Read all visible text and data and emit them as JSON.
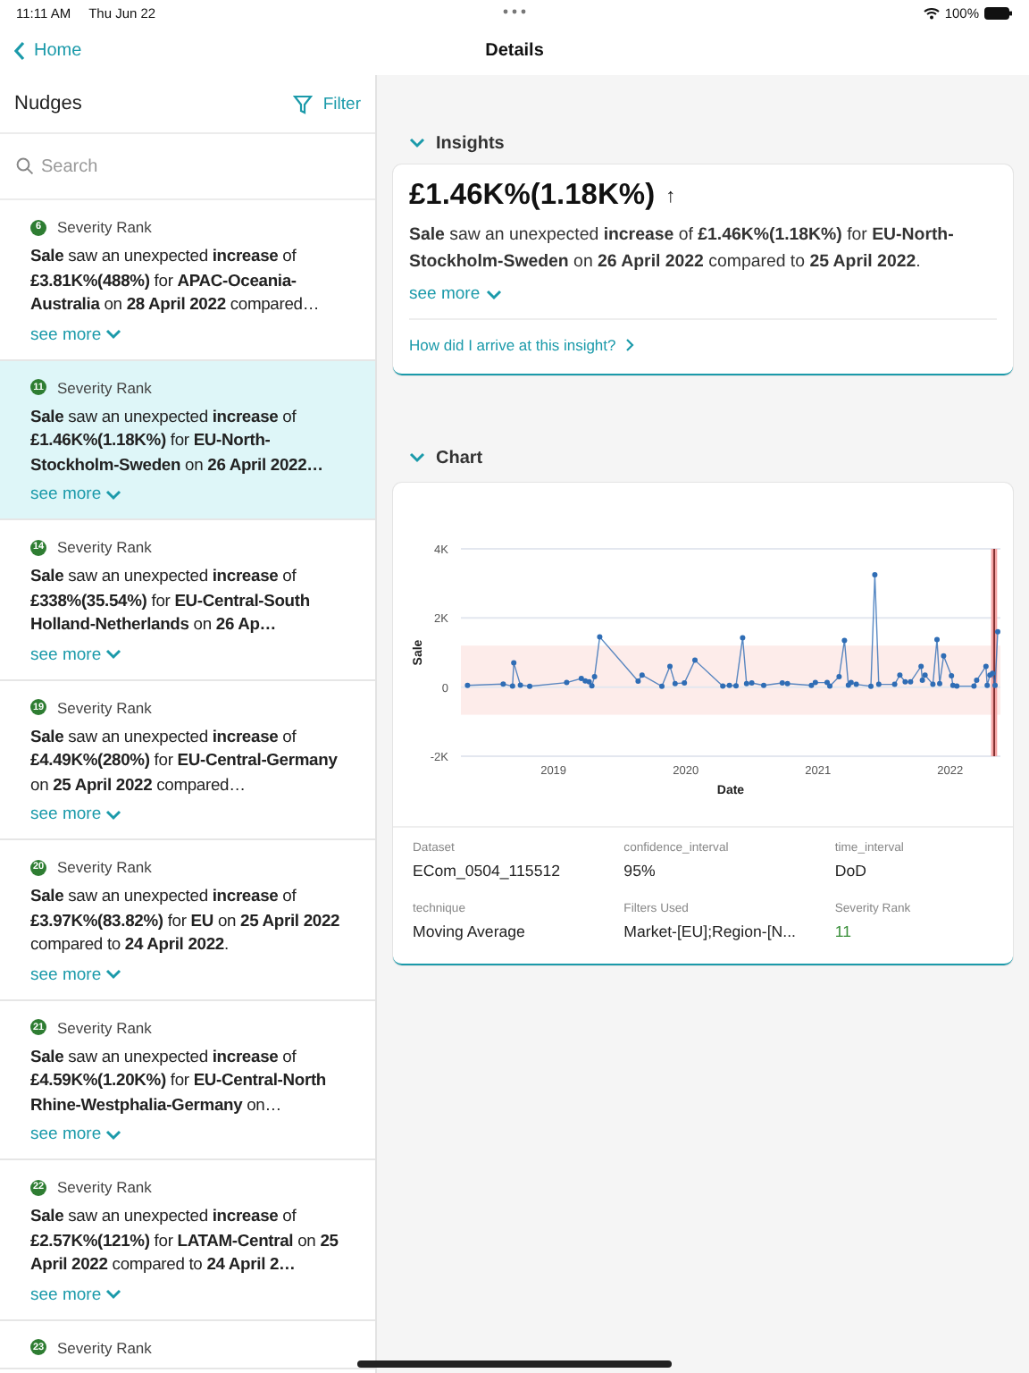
{
  "status_bar": {
    "time": "11:11 AM",
    "date": "Thu Jun 22",
    "battery": "100%"
  },
  "nav": {
    "back": "Home",
    "title": "Details"
  },
  "sidebar": {
    "title": "Nudges",
    "filter": "Filter",
    "search": {
      "placeholder": "Search"
    },
    "nudges": [
      {
        "rank": "6",
        "rank_label": "Severity Rank",
        "text": "**Sale** saw an unexpected **increase** of **£3.81K%(488%)** for **APAC-Oceania-Australia** on **28 April 2022** compared…",
        "see_more": "see more",
        "selected": false
      },
      {
        "rank": "11",
        "rank_label": "Severity Rank",
        "text": "**Sale** saw an unexpected **increase** of **£1.46K%(1.18K%)** for **EU-North-Stockholm-Sweden** on **26 April 2022…**",
        "see_more": "see more",
        "selected": true
      },
      {
        "rank": "14",
        "rank_label": "Severity Rank",
        "text": "**Sale** saw an unexpected **increase** of **£338%(35.54%)** for **EU-Central-South Holland-Netherlands** on **26 Ap…**",
        "see_more": "see more",
        "selected": false
      },
      {
        "rank": "19",
        "rank_label": "Severity Rank",
        "text": "**Sale** saw an unexpected **increase** of **£4.49K%(280%)** for **EU-Central-Germany** on **25 April 2022** compared…",
        "see_more": "see more",
        "selected": false
      },
      {
        "rank": "20",
        "rank_label": "Severity Rank",
        "text": "**Sale** saw an unexpected **increase** of **£3.97K%(83.82%)** for **EU** on **25 April 2022** compared to **24 April 2022**.",
        "see_more": "see more",
        "selected": false
      },
      {
        "rank": "21",
        "rank_label": "Severity Rank",
        "text": "**Sale** saw an unexpected **increase** of **£4.59K%(1.20K%)** for **EU-Central-North Rhine-Westphalia-Germany** on…",
        "see_more": "see more",
        "selected": false
      },
      {
        "rank": "22",
        "rank_label": "Severity Rank",
        "text": "**Sale** saw an unexpected **increase** of **£2.57K%(121%)** for **LATAM-Central** on **25 April 2022** compared to **24 April 2…**",
        "see_more": "see more",
        "selected": false
      },
      {
        "rank": "23",
        "rank_label": "Severity Rank",
        "selected": false
      }
    ]
  },
  "insights": {
    "heading": "Insights",
    "expanded": true,
    "headline": "£1.46K%(1.18K%)",
    "trend": "↑",
    "text": "**Sale** saw an unexpected **increase** of **£1.46K%(1.18K%)** for **EU-North-Stockholm-Sweden** on **26 April 2022** compared to **25 April 2022**.",
    "see_more": "see more",
    "link": "How did I arrive at this insight?"
  },
  "chart_section": {
    "heading": "Chart",
    "expanded": true,
    "chart_data": {
      "type": "line",
      "xlabel": "Date",
      "ylabel": "Sale",
      "xlim": [
        2018.3,
        2022.38
      ],
      "ylim": [
        -2000,
        4000
      ],
      "xticks": [
        2019,
        2020,
        2021,
        2022
      ],
      "yticks": [
        {
          "value": 4000,
          "label": "4K"
        },
        {
          "value": 2000,
          "label": "2K"
        },
        {
          "value": 0,
          "label": "0"
        },
        {
          "value": -2000,
          "label": "-2K"
        }
      ],
      "bands": [
        {
          "axis": "y",
          "from": -800,
          "to": 1200,
          "color": "#fdecea"
        },
        {
          "axis": "x",
          "from": 2022.31,
          "to": 2022.355,
          "color": "#f4a3a3"
        }
      ],
      "ref_lines": [
        {
          "axis": "x",
          "value": 2022.333,
          "color": "#6b1b1b"
        }
      ],
      "series": [
        {
          "color": "#2f6db5",
          "marker": true,
          "x": [
            2018.35,
            2018.62,
            2018.69,
            2018.7,
            2018.75,
            2018.82,
            2019.1,
            2019.21,
            2019.24,
            2019.27,
            2019.29,
            2019.31,
            2019.35,
            2019.64,
            2019.67,
            2019.82,
            2019.88,
            2019.92,
            2019.99,
            2020.07,
            2020.28,
            2020.33,
            2020.38,
            2020.43,
            2020.46,
            2020.5,
            2020.59,
            2020.73,
            2020.77,
            2020.95,
            2020.98,
            2021.07,
            2021.09,
            2021.16,
            2021.2,
            2021.23,
            2021.25,
            2021.29,
            2021.4,
            2021.43,
            2021.46,
            2021.58,
            2021.62,
            2021.66,
            2021.7,
            2021.78,
            2021.79,
            2021.81,
            2021.87,
            2021.9,
            2021.92,
            2021.95,
            2022.01,
            2022.02,
            2022.05,
            2022.18,
            2022.2,
            2022.27,
            2022.28,
            2022.3,
            2022.32,
            2022.34,
            2022.36
          ],
          "values": [
            50,
            90,
            30,
            700,
            60,
            20,
            130,
            250,
            180,
            150,
            40,
            300,
            1450,
            170,
            350,
            20,
            600,
            100,
            120,
            780,
            30,
            50,
            40,
            1430,
            100,
            120,
            50,
            120,
            100,
            50,
            130,
            130,
            30,
            300,
            1350,
            60,
            130,
            80,
            20,
            3250,
            80,
            80,
            350,
            150,
            150,
            600,
            200,
            350,
            80,
            1380,
            100,
            900,
            330,
            50,
            30,
            30,
            200,
            600,
            50,
            350,
            400,
            50,
            1600
          ]
        }
      ]
    },
    "details": [
      {
        "label": "Dataset",
        "value": "ECom_0504_115512",
        "highlight": false
      },
      {
        "label": "confidence_interval",
        "value": "95%",
        "highlight": false
      },
      {
        "label": "time_interval",
        "value": "DoD",
        "highlight": false
      },
      {
        "label": "technique",
        "value": "Moving Average",
        "highlight": false
      },
      {
        "label": "Filters Used",
        "value": "Market-[EU];Region-[N...",
        "highlight": false
      },
      {
        "label": "Severity Rank",
        "value": "11",
        "highlight": true
      }
    ]
  }
}
